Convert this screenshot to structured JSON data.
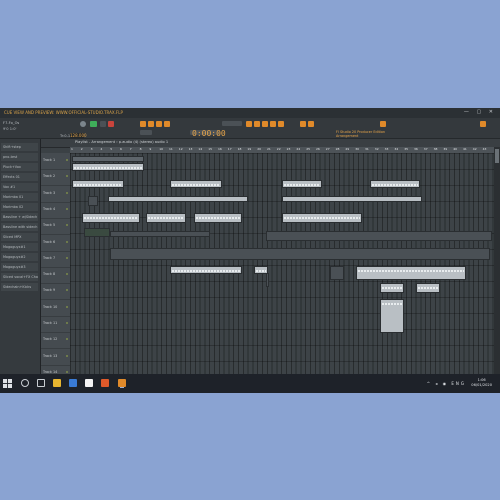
{
  "window": {
    "title": "CUE VIEW AND PREVIEW: WWW.OFFICIAL-STUDIO.TRAX.FLP",
    "controls": "— ▢ ✕"
  },
  "toolbar": {
    "left_line1": "F7-Fo_Os",
    "left_line2": "9'0  1:0'",
    "pattern_label": "Tr:0-13",
    "tempo": "128.000",
    "time": "0:00:00",
    "hint_line1": "Fl Studio 20  Producer Edition",
    "hint_line2": "Arrangement"
  },
  "browser": {
    "items": [
      "Shift+step",
      "pno-test",
      "Pluck+Vox",
      "Effects 01",
      "Vox #1",
      "Marimba 01",
      "Marimba 02",
      "Bassline + w/Sidech",
      "Bassline with sidech",
      "Sliced MPX",
      "Mogoguyx#1",
      "Mogoguyx#2",
      "Mogoguyx#3",
      "Sliced vocal+FX Chain",
      "Sidechain+Kicks"
    ]
  },
  "playlist": {
    "header": "Playlist - Arrangement  › p.audio (4) (stereo) audio 1",
    "ruler": [
      "1",
      "2",
      "3",
      "4",
      "5",
      "6",
      "7",
      "8",
      "9",
      "10",
      "11",
      "12",
      "13",
      "14",
      "15",
      "16",
      "17",
      "18",
      "19",
      "20",
      "21",
      "22",
      "23",
      "24",
      "25",
      "26",
      "27",
      "28",
      "29",
      "30",
      "31",
      "32",
      "33",
      "34",
      "35",
      "36",
      "37",
      "38",
      "39",
      "40",
      "41",
      "42",
      "43"
    ],
    "tracks": [
      "Track 1",
      "Track 2",
      "Track 3",
      "Track 4",
      "Track 5",
      "Track 6",
      "Track 7",
      "Track 8",
      "Track 9",
      "Track 10",
      "Track 11",
      "Track 12",
      "Track 13",
      "Track 14"
    ]
  },
  "taskbar": {
    "time": "1:06",
    "date": "06/01/2020",
    "tray": "^ ◂ ◉ ENG"
  },
  "colors": {
    "accent": "#e08a2a",
    "background": "#8aa3d2",
    "playlist_bg": "#3d4347",
    "clip_light": "#b9bfc4"
  }
}
